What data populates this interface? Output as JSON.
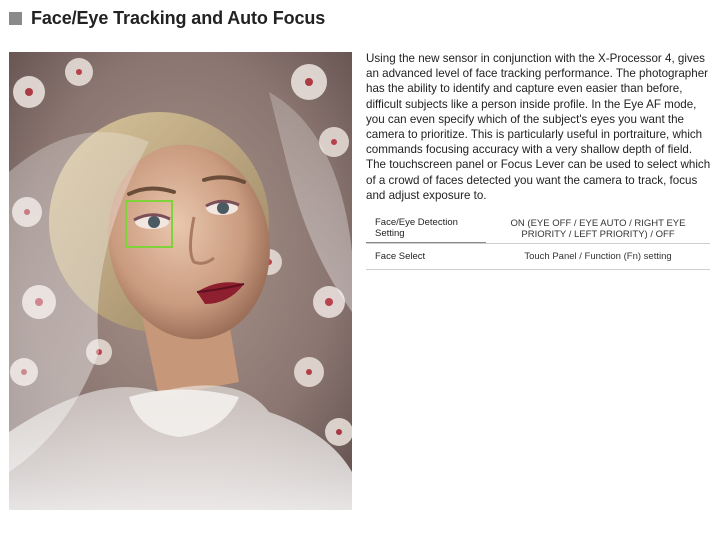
{
  "section": {
    "title": "Face/Eye Tracking and Auto Focus"
  },
  "description": "Using the new sensor in conjunction with the X-Processor 4, gives an advanced level of face tracking performance. The photographer has the ability to identify and capture even easier than before, difficult subjects like a person inside profile. In the Eye AF mode, you can even specify which of the subject's eyes you want the camera to prioritize. This is particularly useful in portraiture, which commands focusing accuracy with a very shallow depth of field. The touchscreen panel or Focus Lever can be used to select which of a crowd of faces detected you want the camera to track, focus and adjust exposure to.",
  "specs": [
    {
      "label": "Face/Eye Detection Setting",
      "value": "ON (EYE OFF / EYE AUTO / RIGHT EYE PRIORITY / LEFT PRIORITY) / OFF"
    },
    {
      "label": "Face Select",
      "value": "Touch Panel / Function (Fn) setting"
    }
  ],
  "colors": {
    "af_frame": "#7fd23a",
    "header_square": "#8a8a8a"
  },
  "icons": {
    "header": "gray-square-icon"
  }
}
